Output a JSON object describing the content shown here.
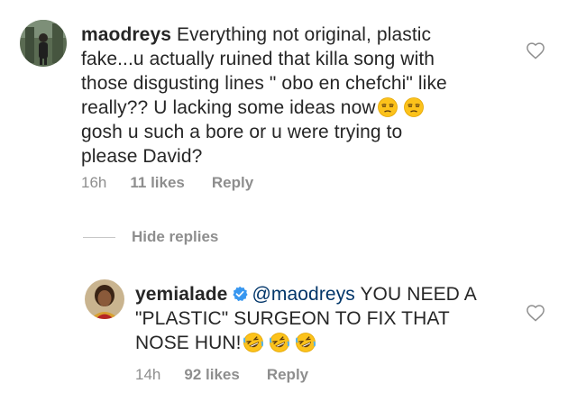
{
  "comments": [
    {
      "username": "maodreys",
      "text_lines": [
        "Everything not original, plastic",
        "fake...u actually ruined that killa song with",
        "those disgusting lines \" obo en chefchi\" like",
        "really?? U lacking some ideas now",
        "gosh u such a bore or u were trying to",
        "please David?"
      ],
      "line4_emojis": [
        "unamused-face",
        "unamused-face"
      ],
      "time": "16h",
      "likes": "11 likes",
      "reply_label": "Reply"
    }
  ],
  "hide_replies_label": "Hide replies",
  "reply": {
    "username": "yemialade",
    "verified": true,
    "mention": "@maodreys",
    "text_line1": "YOU NEED A",
    "text_line2": "\"PLASTIC\" SURGEON TO FIX THAT",
    "text_line3": "NOSE HUN!",
    "emojis": [
      "rolling-on-floor-laughing",
      "rolling-on-floor-laughing",
      "rolling-on-floor-laughing"
    ],
    "time": "14h",
    "likes": "92 likes",
    "reply_label": "Reply"
  },
  "colors": {
    "text": "#262626",
    "meta": "#8e8e8e",
    "mention": "#003569",
    "verified": "#3897f0"
  }
}
